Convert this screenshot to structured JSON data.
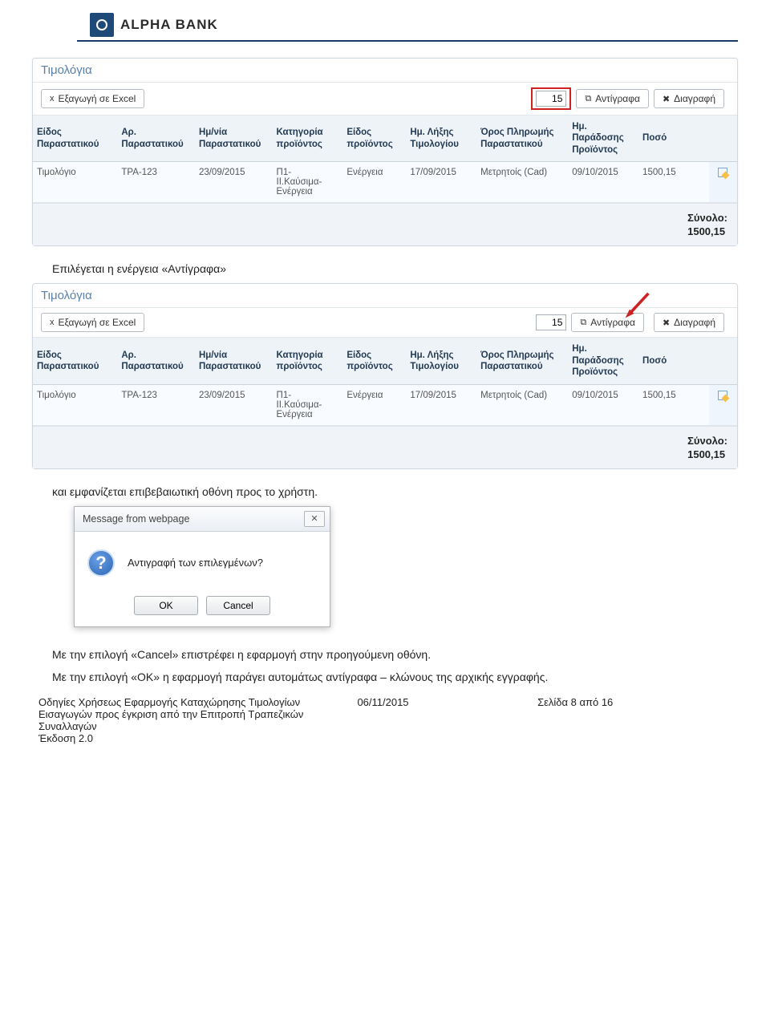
{
  "brand": {
    "name": "ALPHA BANK"
  },
  "table": {
    "title": "Τιμολόγια",
    "export_label": "Εξαγωγή σε Excel",
    "copy_label": "Αντίγραφα",
    "delete_label": "Διαγραφή",
    "copies_value": "15",
    "columns": {
      "type": "Είδος Παραστατικού",
      "number": "Αρ. Παραστατικού",
      "date": "Ημ/νία Παραστατικού",
      "prod_cat": "Κατηγορία προϊόντος",
      "prod_type": "Είδος προϊόντος",
      "expiry": "Ημ. Λήξης Τιμολογίου",
      "payment": "Όρος Πληρωμής Παραστατικού",
      "delivery": "Ημ. Παράδοσης Προϊόντος",
      "amount": "Ποσό"
    },
    "row": {
      "type": "Τιμολόγιο",
      "number": "TPA-123",
      "date": "23/09/2015",
      "prod_cat": "Π1- ΙΙ.Καύσιμα- Ενέργεια",
      "prod_type": "Ενέργεια",
      "expiry": "17/09/2015",
      "payment": "Μετρητοίς (Cad)",
      "delivery": "09/10/2015",
      "amount": "1500,15"
    },
    "total_label": "Σύνολο:",
    "total_value": "1500,15"
  },
  "texts": {
    "select_action": "Επιλέγεται η ενέργεια «Αντίγραφα»",
    "dialog_intro": "και εμφανίζεται επιβεβαιωτική οθόνη προς το χρήστη.",
    "cancel_note": "Με την επιλογή «Cancel» επιστρέφει η εφαρμογή στην προηγούμενη οθόνη.",
    "ok_note": "Με την επιλογή «ΟΚ» η εφαρμογή παράγει αυτομάτως αντίγραφα – κλώνους της αρχικής εγγραφής."
  },
  "dialog": {
    "title": "Message from webpage",
    "message": "Αντιγραφή των επιλεγμένων?",
    "ok": "OK",
    "cancel": "Cancel"
  },
  "footer": {
    "doc_title": "Οδηγίες Χρήσεως Εφαρμογής Καταχώρησης Τιμολογίων Εισαγωγών προς έγκριση από την Επιτροπή Τραπεζικών Συναλλαγών",
    "version": "Έκδοση 2.0",
    "date": "06/11/2015",
    "page": "Σελίδα 8 από 16"
  }
}
